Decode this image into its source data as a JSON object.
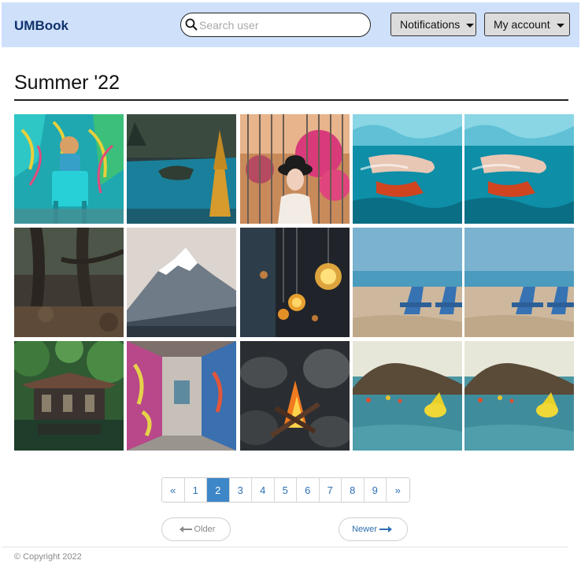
{
  "navbar": {
    "brand": "UMBook",
    "search_placeholder": "Search user",
    "notifications_label": "Notifications",
    "account_label": "My account"
  },
  "album": {
    "title": "Summer '22",
    "photos": [
      {
        "subject": "person in blue chair before graffiti wall"
      },
      {
        "subject": "blue lake with island among pines"
      },
      {
        "subject": "woman in black hat behind bars with pink flowers"
      },
      {
        "subject": "swimmer under turquoise water"
      },
      {
        "subject": "swimmer under turquoise water"
      },
      {
        "subject": "dark forest with twisted trees"
      },
      {
        "subject": "snowy mountain peak"
      },
      {
        "subject": "hanging edison light bulbs"
      },
      {
        "subject": "blue chairs on sandy beach"
      },
      {
        "subject": "blue chairs on sandy beach"
      },
      {
        "subject": "pagoda by green forest pond"
      },
      {
        "subject": "graffiti covered alley"
      },
      {
        "subject": "campfire on rocks"
      },
      {
        "subject": "yellow buoy in sea near hill"
      },
      {
        "subject": "yellow buoy in sea near hill"
      }
    ]
  },
  "pagination": {
    "first": "«",
    "last": "»",
    "pages": [
      "1",
      "2",
      "3",
      "4",
      "5",
      "6",
      "7",
      "8",
      "9"
    ],
    "current": "2"
  },
  "nav_buttons": {
    "older": "Older",
    "newer": "Newer"
  },
  "footer": {
    "copyright": "© Copyright 2022"
  }
}
